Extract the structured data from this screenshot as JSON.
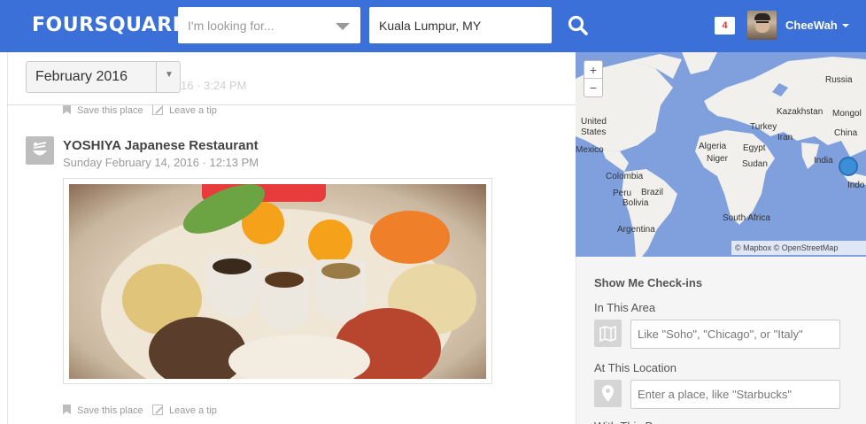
{
  "header": {
    "logo": "FOURSQUARE",
    "looking_for_placeholder": "I'm looking for...",
    "near_value": "Kuala Lumpur, MY",
    "notifications_count": "4",
    "user_name": "CheeWah"
  },
  "feed": {
    "month_selector": "February 2016",
    "prev_checkin_time_fragment": "16 · 3:24 PM",
    "prev_actions": {
      "save": "Save this place",
      "tip": "Leave a tip"
    },
    "checkin": {
      "venue_name": "YOSHIYA Japanese Restaurant",
      "datetime": "Sunday February 14, 2016 · 12:13 PM",
      "actions": {
        "save": "Save this place",
        "tip": "Leave a tip"
      }
    }
  },
  "map": {
    "labels": [
      "Russia",
      "Kazakhstan",
      "Mongol",
      "United States",
      "Turkey",
      "China",
      "Iran",
      "Mexico",
      "Egypt",
      "Algeria",
      "Niger",
      "Sudan",
      "India",
      "Colombia",
      "Peru",
      "Brazil",
      "Bolivia",
      "Argentina",
      "South Africa",
      "Indo"
    ],
    "zoom_in": "+",
    "zoom_out": "−",
    "attribution": "© Mapbox © OpenStreetMap"
  },
  "sidebar": {
    "title": "Show Me Check-ins",
    "area_label": "In This Area",
    "area_placeholder": "Like \"Soho\", \"Chicago\", or \"Italy\"",
    "location_label": "At This Location",
    "location_placeholder": "Enter a place, like \"Starbucks\"",
    "next_label": "With This Person"
  },
  "colors": {
    "brand": "#3a70d8",
    "map_water": "#7fa0dc",
    "notif": "#e03232"
  }
}
